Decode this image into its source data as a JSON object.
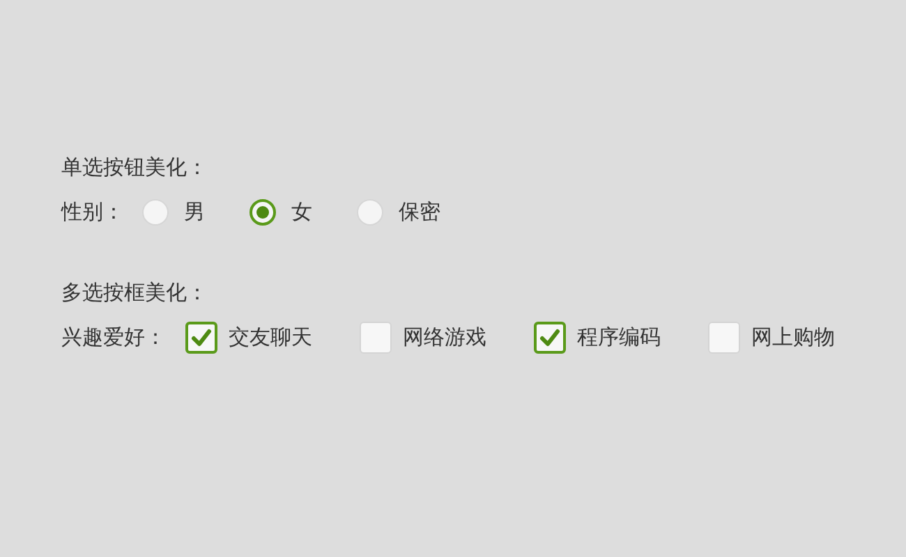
{
  "radio_group": {
    "title": "单选按钮美化：",
    "label": "性别：",
    "options": [
      {
        "label": "男",
        "selected": false
      },
      {
        "label": "女",
        "selected": true
      },
      {
        "label": "保密",
        "selected": false
      }
    ]
  },
  "checkbox_group": {
    "title": "多选按框美化：",
    "label": "兴趣爱好：",
    "options": [
      {
        "label": "交友聊天",
        "checked": true
      },
      {
        "label": "网络游戏",
        "checked": false
      },
      {
        "label": "程序编码",
        "checked": true
      },
      {
        "label": "网上购物",
        "checked": false
      }
    ]
  }
}
